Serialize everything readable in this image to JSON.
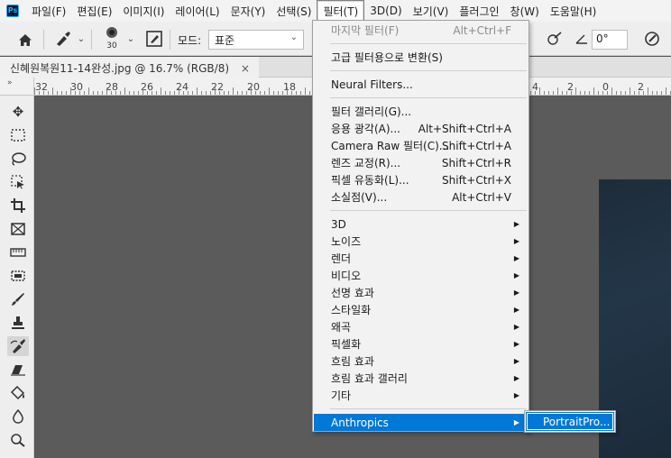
{
  "app": {
    "logo": "Ps"
  },
  "menubar": {
    "items": [
      "파일(F)",
      "편집(E)",
      "이미지(I)",
      "레이어(L)",
      "문자(Y)",
      "선택(S)",
      "필터(T)",
      "3D(D)",
      "보기(V)",
      "플러그인",
      "창(W)",
      "도움말(H)"
    ],
    "active_index": 6
  },
  "options": {
    "home_icon": "home-icon",
    "brush_size": "30",
    "mode_label": "모드:",
    "mode_value": "표준",
    "angle_value": "0°"
  },
  "document": {
    "tab_title": "신혜원복원11-14완성.jpg @ 16.7% (RGB/8)",
    "close_glyph": "×"
  },
  "ruler": {
    "corner_glyph": "»",
    "labels": [
      "32",
      "30",
      "28",
      "26",
      "24",
      "22",
      "20",
      "18",
      "4",
      "2",
      "0",
      "2"
    ]
  },
  "toolbar": {
    "tools": [
      "move-icon",
      "marquee-icon",
      "lasso-icon",
      "object-select-icon",
      "crop-icon",
      "frame-icon",
      "ruler-icon",
      "patch-icon",
      "brush-icon",
      "stamp-icon",
      "history-brush-icon",
      "eraser-icon",
      "paint-bucket-icon",
      "blur-icon",
      "dodge-icon"
    ],
    "selected_index": 10
  },
  "filter_menu": {
    "sections": [
      [
        {
          "label": "마지막 필터(F)",
          "shortcut": "Alt+Ctrl+F",
          "disabled": true
        }
      ],
      [
        {
          "label": "고급 필터용으로 변환(S)"
        }
      ],
      [
        {
          "label": "Neural Filters..."
        }
      ],
      [
        {
          "label": "필터 갤러리(G)..."
        },
        {
          "label": "응용 광각(A)...",
          "shortcut": "Alt+Shift+Ctrl+A"
        },
        {
          "label": "Camera Raw 필터(C)...",
          "shortcut": "Shift+Ctrl+A"
        },
        {
          "label": "렌즈 교정(R)...",
          "shortcut": "Shift+Ctrl+R"
        },
        {
          "label": "픽셀 유동화(L)...",
          "shortcut": "Shift+Ctrl+X"
        },
        {
          "label": "소실점(V)...",
          "shortcut": "Alt+Ctrl+V"
        }
      ],
      [
        {
          "label": "3D",
          "submenu": true
        },
        {
          "label": "노이즈",
          "submenu": true
        },
        {
          "label": "렌더",
          "submenu": true
        },
        {
          "label": "비디오",
          "submenu": true
        },
        {
          "label": "선명 효과",
          "submenu": true
        },
        {
          "label": "스타일화",
          "submenu": true
        },
        {
          "label": "왜곡",
          "submenu": true
        },
        {
          "label": "픽셀화",
          "submenu": true
        },
        {
          "label": "흐림 효과",
          "submenu": true
        },
        {
          "label": "흐림 효과 갤러리",
          "submenu": true
        },
        {
          "label": "기타",
          "submenu": true
        }
      ],
      [
        {
          "label": "Anthropics",
          "submenu": true,
          "highlighted": true
        }
      ]
    ]
  },
  "submenu": {
    "item": "PortraitPro..."
  },
  "colors": {
    "highlight": "#0078d7",
    "menu_bg": "#f2f2f2",
    "canvas_bg": "#5b5b5b"
  }
}
